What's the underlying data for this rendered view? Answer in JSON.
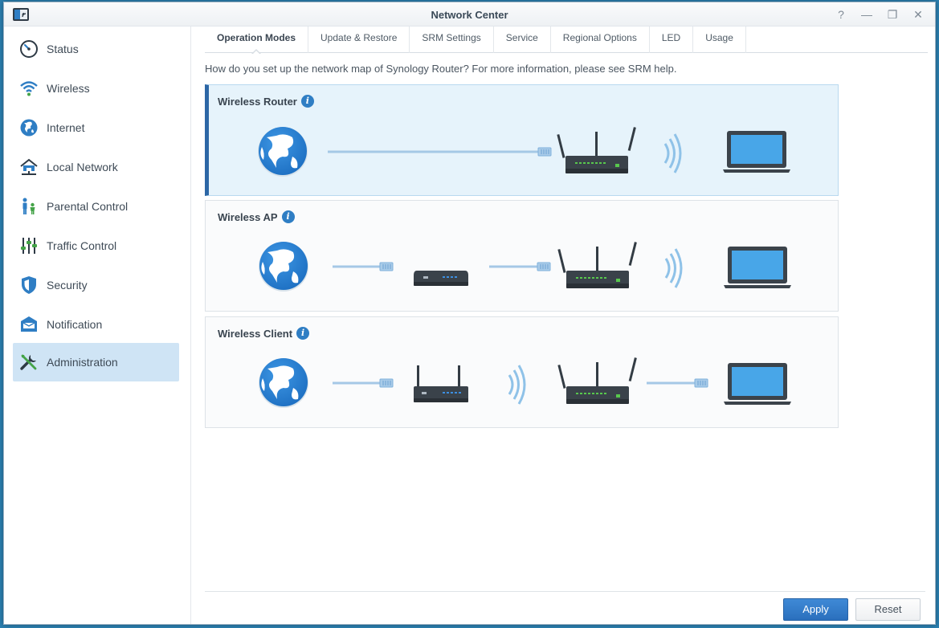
{
  "window": {
    "title": "Network Center",
    "controls": [
      "?",
      "—",
      "❐",
      "✕"
    ]
  },
  "sidebar": {
    "items": [
      {
        "label": "Status",
        "icon": "gauge-icon"
      },
      {
        "label": "Wireless",
        "icon": "wifi-icon"
      },
      {
        "label": "Internet",
        "icon": "globe-icon"
      },
      {
        "label": "Local Network",
        "icon": "home-network-icon"
      },
      {
        "label": "Parental Control",
        "icon": "family-icon"
      },
      {
        "label": "Traffic Control",
        "icon": "sliders-icon"
      },
      {
        "label": "Security",
        "icon": "shield-icon"
      },
      {
        "label": "Notification",
        "icon": "mailbox-icon"
      },
      {
        "label": "Administration",
        "icon": "tools-icon"
      }
    ],
    "active_index": 8
  },
  "tabs": [
    "Operation Modes",
    "Update & Restore",
    "SRM Settings",
    "Service",
    "Regional Options",
    "LED",
    "Usage"
  ],
  "active_tab": 0,
  "question": "How do you set up the network map of Synology Router? For more information, please see SRM help.",
  "modes": [
    {
      "title": "Wireless Router",
      "selected": true
    },
    {
      "title": "Wireless AP",
      "selected": false
    },
    {
      "title": "Wireless Client",
      "selected": false
    }
  ],
  "info_glyph": "i",
  "buttons": {
    "apply": "Apply",
    "reset": "Reset"
  },
  "colors": {
    "accent": "#2d67a6",
    "selected_bg": "#e6f3fb",
    "apply_bg": "#3f8ad6"
  }
}
